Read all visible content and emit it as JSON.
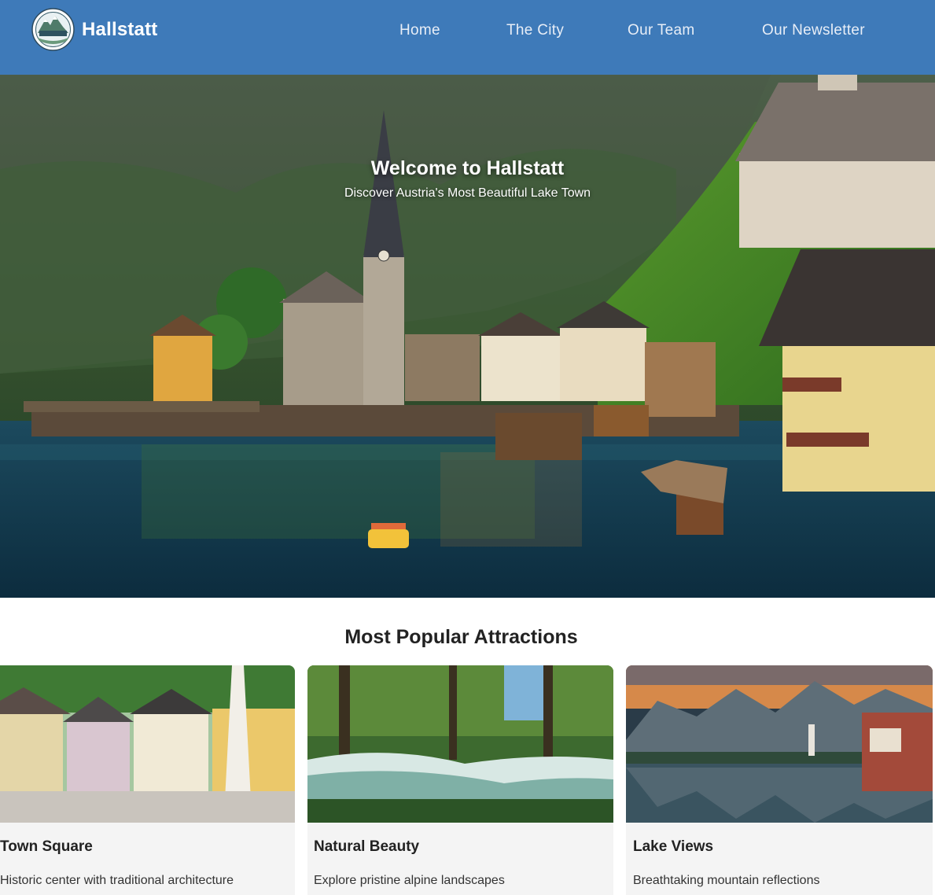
{
  "brand": {
    "name": "Hallstatt",
    "logo_text": "HALLSTATT",
    "logo_icon": "mountain-badge-logo"
  },
  "nav": {
    "items": [
      {
        "label": "Home"
      },
      {
        "label": "The City"
      },
      {
        "label": "Our Team"
      },
      {
        "label": "Our Newsletter"
      }
    ]
  },
  "hero": {
    "title": "Welcome to Hallstatt",
    "subtitle": "Discover Austria's Most Beautiful Lake Town",
    "image": "hallstatt-lake-village-photo"
  },
  "attractions": {
    "heading": "Most Popular Attractions",
    "cards": [
      {
        "title": "Town Square",
        "description": "Historic center with traditional architecture",
        "image": "town-square-photo"
      },
      {
        "title": "Natural Beauty",
        "description": "Explore pristine alpine landscapes",
        "image": "alpine-stream-photo"
      },
      {
        "title": "Lake Views",
        "description": "Breathtaking mountain reflections",
        "image": "lake-mountain-reflection-photo"
      }
    ]
  },
  "colors": {
    "navbar": "#3e7ab9",
    "card_bg": "#f4f4f4",
    "text": "#222222"
  }
}
